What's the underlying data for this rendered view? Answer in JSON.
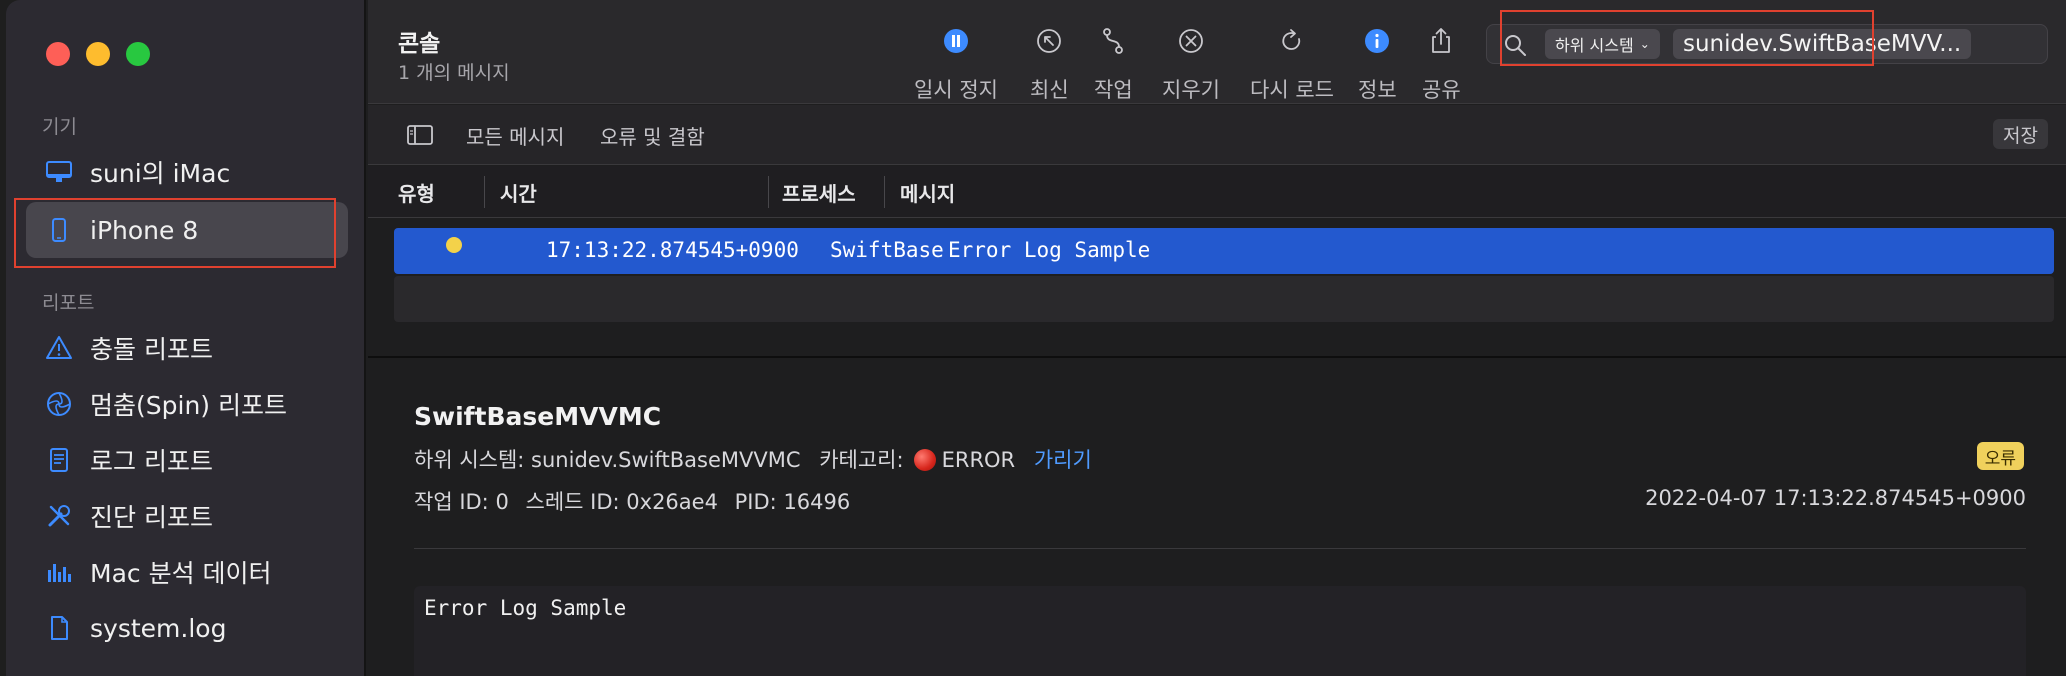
{
  "sidebar": {
    "devices_header": "기기",
    "reports_header": "리포트",
    "devices": [
      {
        "label": "suni의 iMac",
        "icon": "imac-icon"
      },
      {
        "label": "iPhone 8",
        "icon": "iphone-icon",
        "selected": true
      }
    ],
    "reports": [
      {
        "label": "충돌 리포트",
        "icon": "warning-triangle-icon"
      },
      {
        "label": "멈춤(Spin) 리포트",
        "icon": "spinner-wheel-icon"
      },
      {
        "label": "로그 리포트",
        "icon": "document-icon"
      },
      {
        "label": "진단 리포트",
        "icon": "tools-icon"
      },
      {
        "label": "Mac 분석 데이터",
        "icon": "bar-chart-icon"
      },
      {
        "label": "system.log",
        "icon": "file-icon"
      }
    ]
  },
  "toolbar": {
    "title": "콘솔",
    "subtitle": "1 개의 메시지",
    "buttons": [
      {
        "label": "일시 정지",
        "icon": "pause-icon"
      },
      {
        "label": "최신",
        "icon": "now-arrow-icon"
      },
      {
        "label": "작업",
        "icon": "activities-icon"
      },
      {
        "label": "지우기",
        "icon": "clear-icon"
      },
      {
        "label": "다시 로드",
        "icon": "reload-icon"
      },
      {
        "label": "정보",
        "icon": "info-icon"
      },
      {
        "label": "공유",
        "icon": "share-icon"
      }
    ],
    "search": {
      "token_key": "하위 시스템",
      "token_value": "sunidev.SwiftBaseMVV..."
    }
  },
  "filterbar": {
    "tabs": [
      "모든 메시지",
      "오류 및 결함"
    ],
    "save_label": "저장"
  },
  "table": {
    "headers": [
      "유형",
      "시간",
      "프로세스",
      "메시지"
    ],
    "rows": [
      {
        "type": "error",
        "time": "17:13:22.874545+0900",
        "process": "SwiftBase",
        "message": "Error Log Sample"
      }
    ]
  },
  "detail": {
    "process_name": "SwiftBaseMVVMC",
    "subsystem_key": "하위 시스템:",
    "subsystem_value": "sunidev.SwiftBaseMVVMC",
    "category_key": "카테고리:",
    "category_value": "ERROR",
    "hide_link": "가리기",
    "badge": "오류",
    "activity_key": "작업 ID:",
    "activity_value": "0",
    "thread_key": "스레드 ID:",
    "thread_value": "0x26ae4",
    "pid_key": "PID:",
    "pid_value": "16496",
    "timestamp": "2022-04-07 17:13:22.874545+0900",
    "message": "Error Log Sample"
  },
  "colors": {
    "accent": "#2359cf",
    "highlight_box": "#e0412f",
    "error_badge": "#f0d15c",
    "link": "#4f9bff"
  }
}
